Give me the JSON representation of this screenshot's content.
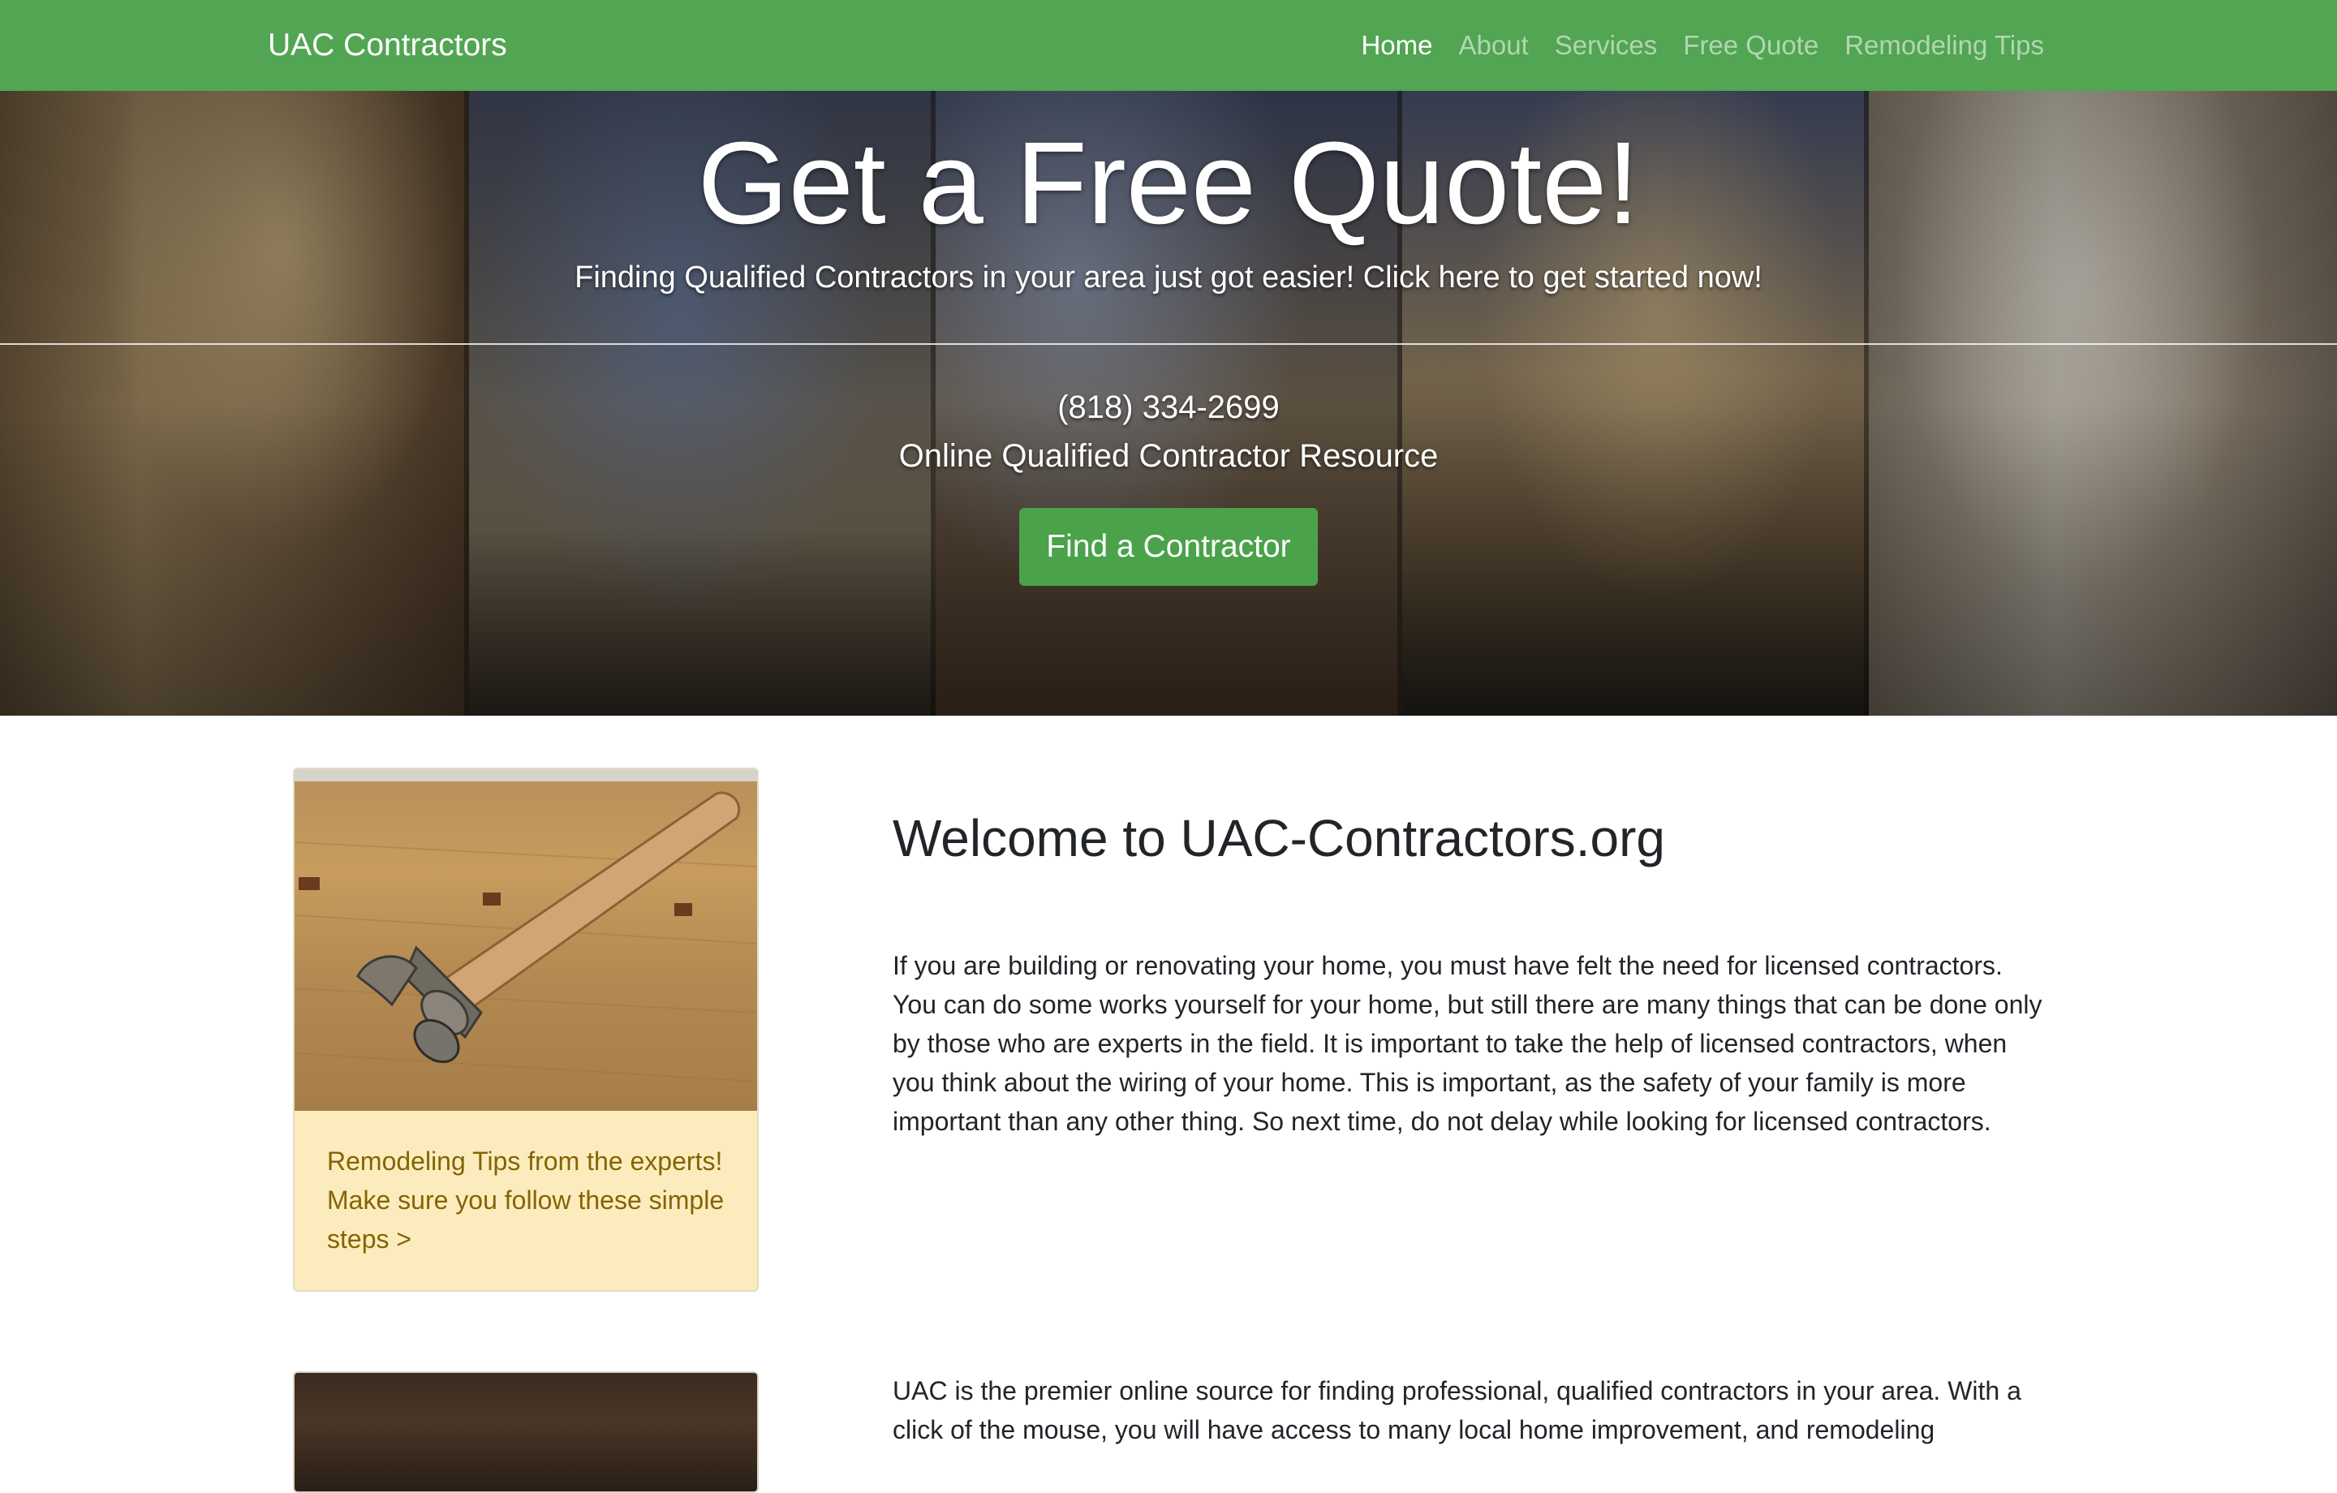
{
  "navbar": {
    "brand": "UAC Contractors",
    "links": [
      {
        "label": "Home",
        "active": true
      },
      {
        "label": "About",
        "active": false
      },
      {
        "label": "Services",
        "active": false
      },
      {
        "label": "Free Quote",
        "active": false
      },
      {
        "label": "Remodeling Tips",
        "active": false
      }
    ]
  },
  "hero": {
    "title": "Get a Free Quote!",
    "lead": "Finding Qualified Contractors in your area just got easier! Click here to get started now!",
    "phone": "(818) 334-2699",
    "tagline": "Online Qualified Contractor Resource",
    "button_label": "Find a Contractor"
  },
  "tips_card": {
    "text": "Remodeling Tips from the experts! Make sure you follow these simple steps >"
  },
  "main": {
    "heading": "Welcome to UAC-Contractors.org",
    "paragraph1": "If you are building or renovating your home, you must have felt the need for licensed contractors. You can do some works yourself for your home, but still there are many things that can be done only by those who are experts in the field. It is important to take the help of licensed contractors, when you think about the wiring of your home. This is important, as the safety of your family is more important than any other thing. So next time, do not delay while looking for licensed contractors.",
    "paragraph2": "UAC is the premier online source for finding professional, qualified contractors in your area. With a click of the mouse, you will have access to many local home improvement, and remodeling"
  },
  "colors": {
    "navbar": "#52a552",
    "button": "#4aa24a",
    "card_body": "#fcecbd",
    "card_text": "#856404"
  }
}
